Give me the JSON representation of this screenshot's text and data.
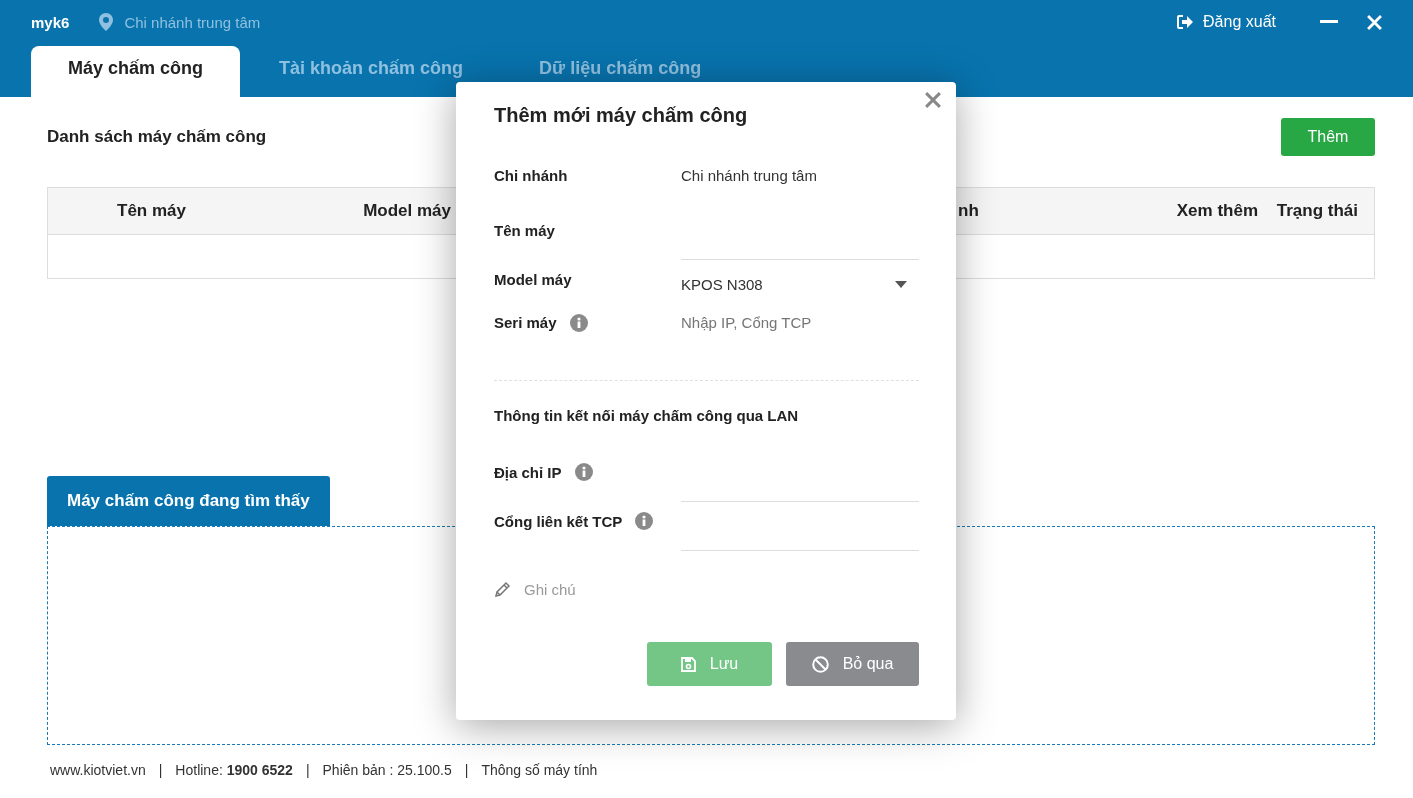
{
  "header": {
    "user": "myk6",
    "branch": "Chi nhánh trung tâm",
    "logout": "Đăng xuất"
  },
  "tabs": [
    {
      "label": "Máy chấm công",
      "selected": true
    },
    {
      "label": "Tài khoản chấm công",
      "selected": false
    },
    {
      "label": "Dữ liệu chấm công",
      "selected": false
    }
  ],
  "list": {
    "title": "Danh sách máy chấm công",
    "add_button": "Thêm",
    "columns": [
      "Tên máy",
      "Model máy",
      "nh",
      "Xem thêm",
      "Trạng thái"
    ]
  },
  "found_panel": {
    "title": "Máy chấm công đang tìm thấy"
  },
  "footer": {
    "separator": "|",
    "items": [
      "www.kiotviet.vn",
      "Hotline: **1900 6522**",
      "Phiên bản : 25.100.5",
      "Thông số máy tính"
    ]
  },
  "dialog": {
    "title": "Thêm mới máy chấm công",
    "fields": [
      {
        "kind": "text",
        "label": "Chi nhánh",
        "info": false,
        "value": "Chi nhánh trung tâm"
      },
      {
        "kind": "input",
        "label": "Tên máy",
        "info": false
      },
      {
        "kind": "select",
        "label": "Model máy",
        "info": false,
        "value": "KPOS N308"
      },
      {
        "kind": "plain",
        "label": "Seri máy",
        "info": true,
        "placeholder": "Nhập IP, Cổng TCP"
      }
    ],
    "section_title": "Thông tin kết nối máy chấm công qua LAN",
    "lan_fields": [
      {
        "kind": "input",
        "label": "Địa chỉ IP",
        "info": true
      },
      {
        "kind": "input",
        "label": "Cổng liên kết TCP",
        "info": true
      }
    ],
    "note_placeholder": "Ghi chú",
    "buttons": [
      {
        "kind": "save",
        "label": "Lưu",
        "disabled": true
      },
      {
        "kind": "cancel",
        "label": "Bỏ qua",
        "disabled": false
      }
    ]
  }
}
